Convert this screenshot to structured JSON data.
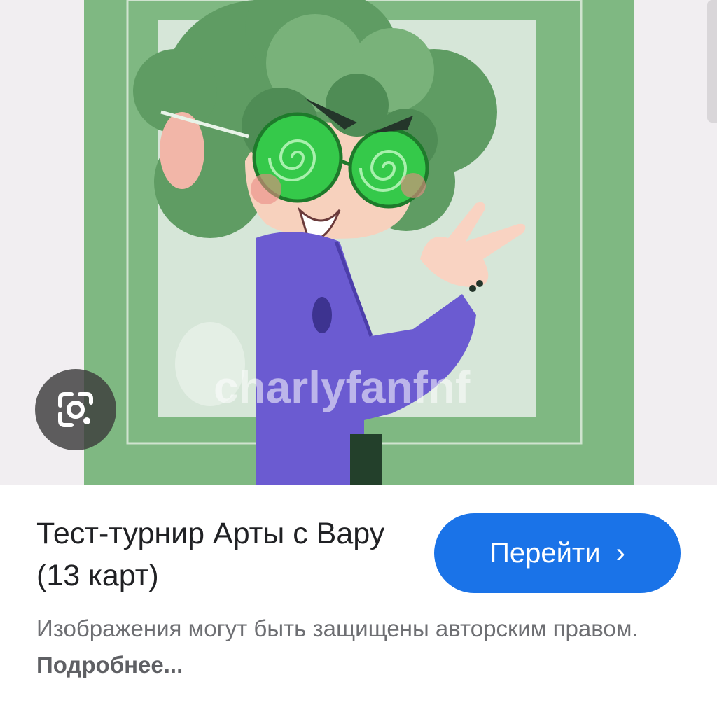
{
  "result": {
    "title": "Тест-турнир Арты с Вару (13 карт)",
    "visit_label": "Перейти",
    "visit_icon": "chevron-right-icon",
    "accent": "#1a73e8"
  },
  "notice": {
    "text": "Изображения могут быть защищены авторским правом.",
    "more_label": "Подробнее..."
  },
  "image": {
    "watermark": "charlyfanfnf",
    "lens_icon": "google-lens-icon"
  }
}
